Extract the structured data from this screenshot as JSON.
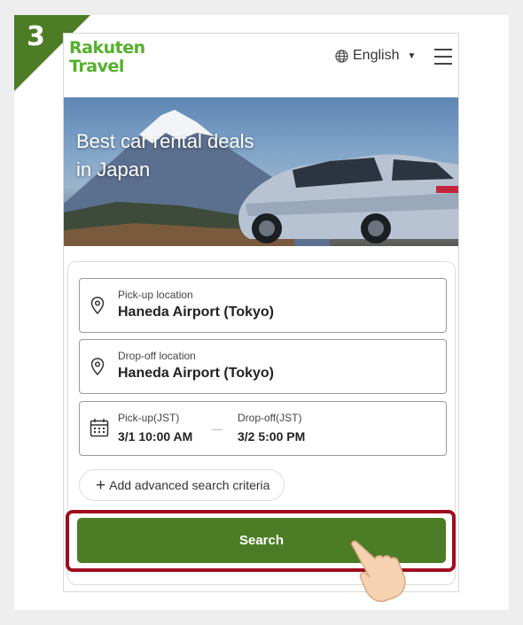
{
  "step": {
    "number": "3"
  },
  "header": {
    "logo_line1": "Rakuten",
    "logo_line2": "Travel",
    "language": "English"
  },
  "hero": {
    "title_line1": "Best car rental deals",
    "title_line2": "in Japan"
  },
  "form": {
    "pickup_location": {
      "label": "Pick-up location",
      "value": "Haneda Airport (Tokyo)"
    },
    "dropoff_location": {
      "label": "Drop-off location",
      "value": "Haneda Airport (Tokyo)"
    },
    "pickup_time": {
      "label": "Pick-up(JST)",
      "value": "3/1 10:00 AM"
    },
    "dropoff_time": {
      "label": "Drop-off(JST)",
      "value": "3/2 5:00 PM"
    },
    "advanced_label": "Add advanced search criteria",
    "search_label": "Search"
  },
  "colors": {
    "brand_green": "#55b02b",
    "button_green": "#4d7c27",
    "highlight_red": "#a00c1e"
  },
  "icons": [
    "globe-icon",
    "caret-down-icon",
    "hamburger-menu-icon",
    "location-pin-icon",
    "calendar-icon",
    "plus-icon",
    "pointing-hand-icon"
  ]
}
